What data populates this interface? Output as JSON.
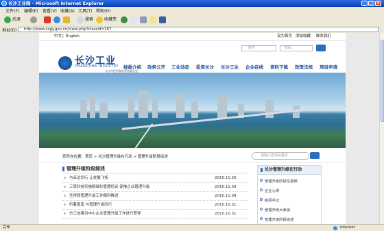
{
  "window": {
    "title": "长沙工业网 - Microsoft Internet Explorer"
  },
  "menu": [
    "文件(F)",
    "编辑(E)",
    "查看(V)",
    "收藏(A)",
    "工具(T)",
    "帮助(H)"
  ],
  "toolbar": {
    "back": "后退",
    "search": "搜索",
    "favorites": "收藏夹"
  },
  "address": {
    "label": "地址(D)",
    "url": "http://www.csgy.gov.cn/class.php?classid=167"
  },
  "status": {
    "left": "完毕",
    "zone": "Internet"
  },
  "page": {
    "lang": {
      "zh": "中文",
      "sep": "|",
      "en": "English"
    },
    "top_links": [
      "设为首页",
      "添加收藏",
      "联系我们"
    ],
    "logo": {
      "title": "长沙工业",
      "sub": "CHANGSHA INDUSTRY",
      "sub2": "长沙市经济和信息化委员会"
    },
    "login": {
      "account_placeholder": "账号",
      "password_placeholder": "密码"
    },
    "nav": [
      "经委介绍",
      "政务公开",
      "工业动态",
      "投资长沙",
      "长沙工业",
      "企业在线",
      "资料下载",
      "政策法规",
      "项目申请"
    ],
    "breadcrumb": "您所在位置：首页 > 长沙管理升级在行动 > 管理升级阶段综述",
    "keyword_placeholder": "请输入查询关键字",
    "section_title": "管理升级阶段综述",
    "articles": [
      {
        "title": "与亚运同行 让发展飞扬",
        "date": "2010.11.26"
      },
      {
        "title": "三思科技实施精细化管理培训 促推企业管理升级",
        "date": "2010.11.09"
      },
      {
        "title": "圣得西管理升级工作顺利推进",
        "date": "2010.11.09"
      },
      {
        "title": "听着盈富 与管理升级同行",
        "date": "2010.10.31"
      },
      {
        "title": "市工信委对中小企业管理升级工作进行督导",
        "date": "2010.10.31"
      }
    ],
    "sidebar": {
      "title": "长沙管理升级在行动",
      "items": [
        "管理升级阶段性视频",
        "企业心得",
        "新闻手记",
        "管理升级大家谈",
        "管理升级阶段综述"
      ]
    }
  }
}
